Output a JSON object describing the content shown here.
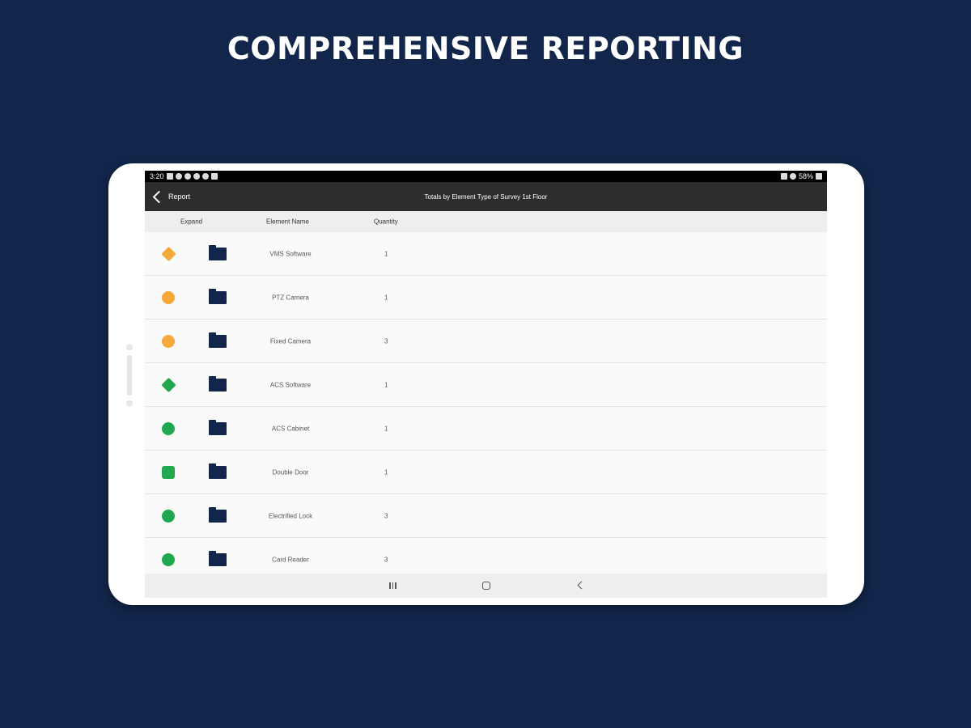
{
  "headline": "COMPREHENSIVE REPORTING",
  "statusbar": {
    "time": "3:20",
    "battery": "58%"
  },
  "appbar": {
    "back_label": "Report",
    "title": "Totals by Element Type of Survey 1st Floor"
  },
  "table": {
    "headers": {
      "expand": "Expand",
      "name": "Element Name",
      "quantity": "Quantity"
    },
    "rows": [
      {
        "name": "VMS Software",
        "quantity": "1",
        "badge_color": "#f4a93a",
        "badge_shape": "diamond",
        "icon": "vms-software-icon"
      },
      {
        "name": "PTZ Camera",
        "quantity": "1",
        "badge_color": "#f4a93a",
        "badge_shape": "circle",
        "icon": "ptz-camera-icon"
      },
      {
        "name": "Fixed Camera",
        "quantity": "3",
        "badge_color": "#f4a93a",
        "badge_shape": "circle",
        "icon": "fixed-camera-icon"
      },
      {
        "name": "ACS Software",
        "quantity": "1",
        "badge_color": "#1fa84f",
        "badge_shape": "diamond",
        "icon": "acs-software-icon"
      },
      {
        "name": "ACS Cabinet",
        "quantity": "1",
        "badge_color": "#1fa84f",
        "badge_shape": "circle",
        "icon": "acs-cabinet-icon"
      },
      {
        "name": "Double Door",
        "quantity": "1",
        "badge_color": "#1fa84f",
        "badge_shape": "shield",
        "icon": "double-door-icon"
      },
      {
        "name": "Electrified Lock",
        "quantity": "3",
        "badge_color": "#1fa84f",
        "badge_shape": "circle",
        "icon": "electrified-lock-icon"
      },
      {
        "name": "Card Reader",
        "quantity": "3",
        "badge_color": "#1fa84f",
        "badge_shape": "circle",
        "icon": "card-reader-icon"
      }
    ]
  },
  "colors": {
    "background": "#11264a",
    "appbar": "#2d2d2d",
    "folder": "#11264a"
  }
}
